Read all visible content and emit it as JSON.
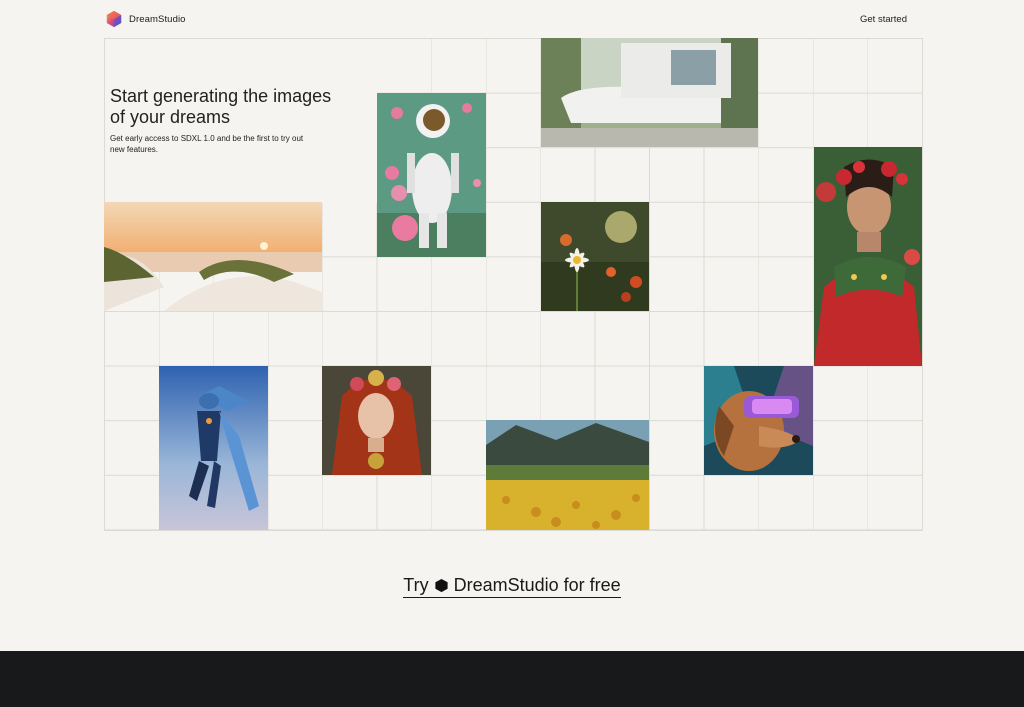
{
  "header": {
    "brand": "DreamStudio",
    "get_started": "Get started"
  },
  "hero": {
    "title": "Start generating the images of your dreams",
    "subtitle": "Get early access to SDXL 1.0 and be the first to try out new features."
  },
  "gallery": {
    "images": [
      {
        "name": "astronaut-image",
        "subject": "astronaut among pink roses"
      },
      {
        "name": "modern-house-image",
        "subject": "futuristic white house in forest"
      },
      {
        "name": "beach-dunes-image",
        "subject": "sand dunes at sunset"
      },
      {
        "name": "daisy-image",
        "subject": "daisy in a field"
      },
      {
        "name": "portrait-flower-crown-woman-image",
        "subject": "woman with flower crown and embroidered blouse"
      },
      {
        "name": "flying-robot-image",
        "subject": "blue armored robot flying"
      },
      {
        "name": "redhead-portrait-image",
        "subject": "red-haired woman with floral crown"
      },
      {
        "name": "flower-meadow-image",
        "subject": "yellow flower meadow with mountains"
      },
      {
        "name": "dog-vr-image",
        "subject": "dog wearing VR headset"
      }
    ]
  },
  "cta": {
    "prefix": "Try",
    "brand": "DreamStudio for free"
  },
  "colors": {
    "background": "#f5f4f0",
    "grid_line": "#dcdad4",
    "footer": "#18191b",
    "text": "#1a1a1a"
  }
}
